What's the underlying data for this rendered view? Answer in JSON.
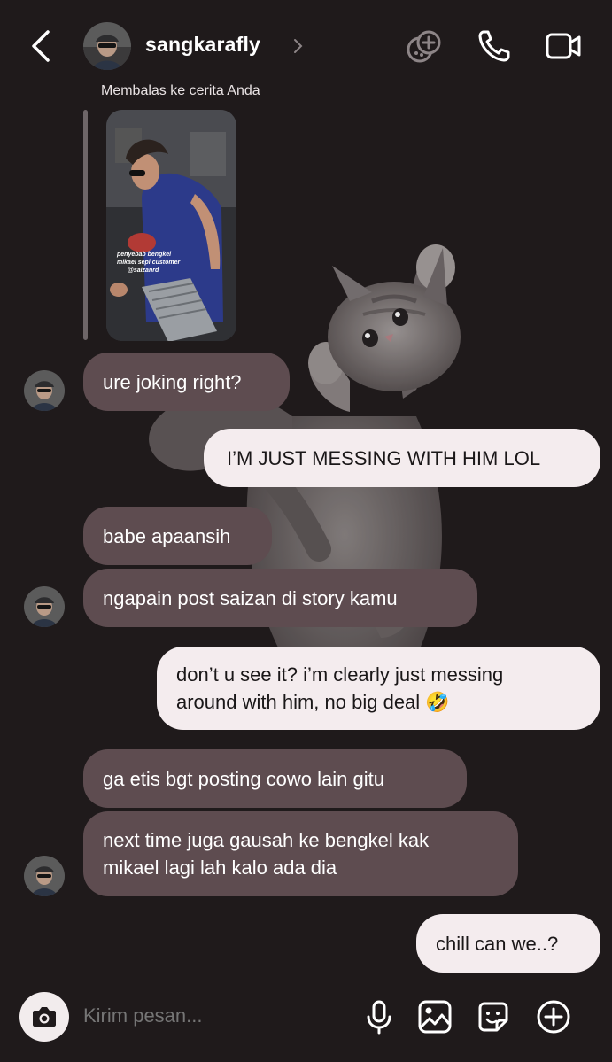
{
  "header": {
    "username": "sangkarafly",
    "icons": [
      "back-icon",
      "chevron-right-icon",
      "effects-icon",
      "phone-icon",
      "video-icon"
    ]
  },
  "reply_context": {
    "label": "Membalas ke cerita Anda",
    "story_caption": "penyebab bengkel\nmikael sepi customer\n@saizanrd"
  },
  "messages": [
    {
      "sender": "them",
      "text": "ure joking right?"
    },
    {
      "sender": "me",
      "text": "I’M JUST MESSING WITH HIM LOL"
    },
    {
      "sender": "them",
      "text": "babe apaansih"
    },
    {
      "sender": "them",
      "text": "ngapain post saizan di story kamu"
    },
    {
      "sender": "me",
      "text": "don’t u see it? i’m clearly just messing\naround with him, no big deal 🤣"
    },
    {
      "sender": "them",
      "text": "ga etis bgt posting cowo lain gitu"
    },
    {
      "sender": "them",
      "text": "next time juga gausah ke bengkel kak\nmikael lagi lah kalo ada dia"
    },
    {
      "sender": "me",
      "text": "chill can we..?"
    }
  ],
  "composer": {
    "placeholder": "Kirim pesan...",
    "icons": [
      "camera-icon",
      "microphone-icon",
      "gallery-icon",
      "sticker-icon",
      "add-icon"
    ]
  },
  "colors": {
    "background": "#1f1a1b",
    "received_bubble": "#5e4c50",
    "sent_bubble": "#f4ecee"
  }
}
